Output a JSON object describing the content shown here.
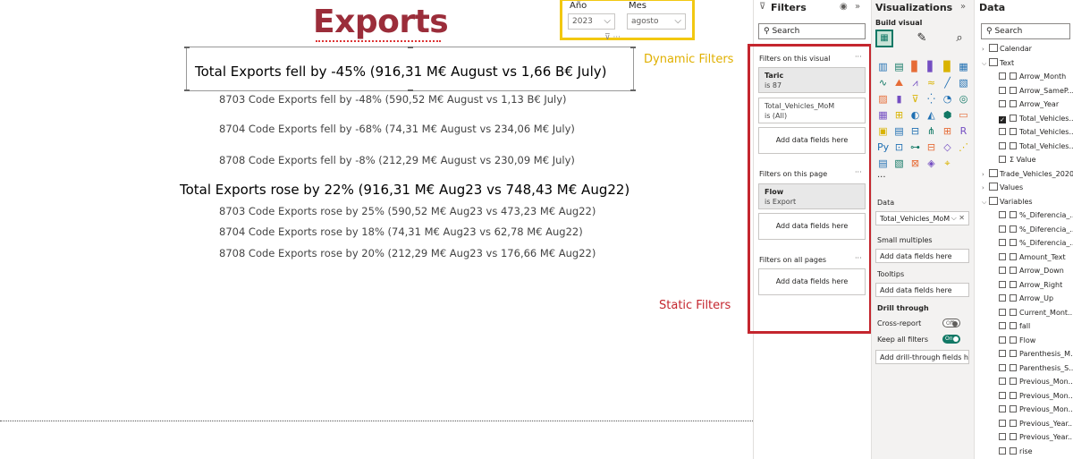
{
  "canvas": {
    "title": "Exports",
    "slicer_year": {
      "label": "Año",
      "value": "2023"
    },
    "slicer_month": {
      "label": "Mes",
      "value": "agosto"
    },
    "slicer_icons": "⊽ ···",
    "dynamic_annotation": "Dynamic Filters",
    "static_annotation": "Static Filters",
    "dynamic_main": "Total Exports fell by -45% (916,31 M€ August vs 1,66 B€ July)",
    "dynamic_lines": [
      "8703 Code Exports fell by -48% (590,52 M€ August vs 1,13 B€ July)",
      "8704 Code Exports fell by -68% (74,31 M€ August vs 234,06 M€ July)",
      "8708 Code Exports fell by -8% (212,29 M€ August vs 230,09 M€ July)"
    ],
    "static_main": "Total Exports rose by 22% (916,31 M€ Aug23 vs 748,43 M€ Aug22)",
    "static_lines": [
      "8703 Code Exports rose by 25% (590,52 M€ Aug23 vs 473,23 M€ Aug22)",
      "8704 Code Exports rose by 18% (74,31 M€ Aug23 vs 62,78 M€ Aug22)",
      "8708 Code Exports rose by 20% (212,29 M€ Aug23 vs 176,66 M€ Aug22)"
    ],
    "annotation_colors": {
      "dynamic": "#e0b000",
      "static": "#c4262e"
    }
  },
  "filters": {
    "title": "Filters",
    "search_placeholder": "Search",
    "on_visual": "Filters on this visual",
    "taric_title": "Taric",
    "taric_sub": "is 87",
    "mom_title": "Total_Vehicles_MoM",
    "mom_sub": "is (All)",
    "add_fields": "Add data fields here",
    "on_page": "Filters on this page",
    "flow_title": "Flow",
    "flow_sub": "is Export",
    "on_all": "Filters on all pages",
    "dots": "···"
  },
  "viz": {
    "title": "Visualizations",
    "build_visual": "Build visual",
    "more": "···",
    "data_label": "Data",
    "data_field": "Total_Vehicles_MoM",
    "small_multiples": "Small multiples",
    "add_fields": "Add data fields here",
    "tooltips": "Tooltips",
    "drill_through": "Drill through",
    "cross_report": "Cross-report",
    "cross_report_state": "Off",
    "keep_filters": "Keep all filters",
    "keep_filters_state": "On",
    "add_drill": "Add drill-through fields here"
  },
  "data": {
    "title": "Data",
    "search_placeholder": "Search",
    "tree": [
      {
        "label": "Calendar",
        "type": "table",
        "expanded": false
      },
      {
        "label": "Text",
        "type": "table",
        "expanded": true
      },
      {
        "label": "Arrow_Month",
        "type": "field",
        "checked": false
      },
      {
        "label": "Arrow_SameP...",
        "type": "field",
        "checked": false
      },
      {
        "label": "Arrow_Year",
        "type": "field",
        "checked": false
      },
      {
        "label": "Total_Vehicles...",
        "type": "field",
        "checked": true
      },
      {
        "label": "Total_Vehicles...",
        "type": "field",
        "checked": false
      },
      {
        "label": "Total_Vehicles...",
        "type": "field",
        "checked": false
      },
      {
        "label": "Value",
        "type": "sigma",
        "checked": false
      },
      {
        "label": "Trade_Vehicles_2020...",
        "type": "table",
        "expanded": false
      },
      {
        "label": "Values",
        "type": "table",
        "expanded": false
      },
      {
        "label": "Variables",
        "type": "table",
        "expanded": true
      },
      {
        "label": "%_Diferencia_...",
        "type": "field",
        "checked": false
      },
      {
        "label": "%_Diferencia_...",
        "type": "field",
        "checked": false
      },
      {
        "label": "%_Diferencia_...",
        "type": "field",
        "checked": false
      },
      {
        "label": "Amount_Text",
        "type": "field",
        "checked": false
      },
      {
        "label": "Arrow_Down",
        "type": "field",
        "checked": false
      },
      {
        "label": "Arrow_Right",
        "type": "field",
        "checked": false
      },
      {
        "label": "Arrow_Up",
        "type": "field",
        "checked": false
      },
      {
        "label": "Current_Mont...",
        "type": "field",
        "checked": false
      },
      {
        "label": "fall",
        "type": "field",
        "checked": false
      },
      {
        "label": "Flow",
        "type": "field",
        "checked": false
      },
      {
        "label": "Parenthesis_M...",
        "type": "field",
        "checked": false
      },
      {
        "label": "Parenthesis_S...",
        "type": "field",
        "checked": false
      },
      {
        "label": "Previous_Mon...",
        "type": "field",
        "checked": false
      },
      {
        "label": "Previous_Mon...",
        "type": "field",
        "checked": false
      },
      {
        "label": "Previous_Mon...",
        "type": "field",
        "checked": false
      },
      {
        "label": "Previous_Year...",
        "type": "field",
        "checked": false
      },
      {
        "label": "Previous_Year...",
        "type": "field",
        "checked": false
      },
      {
        "label": "rise",
        "type": "field",
        "checked": false
      }
    ]
  }
}
